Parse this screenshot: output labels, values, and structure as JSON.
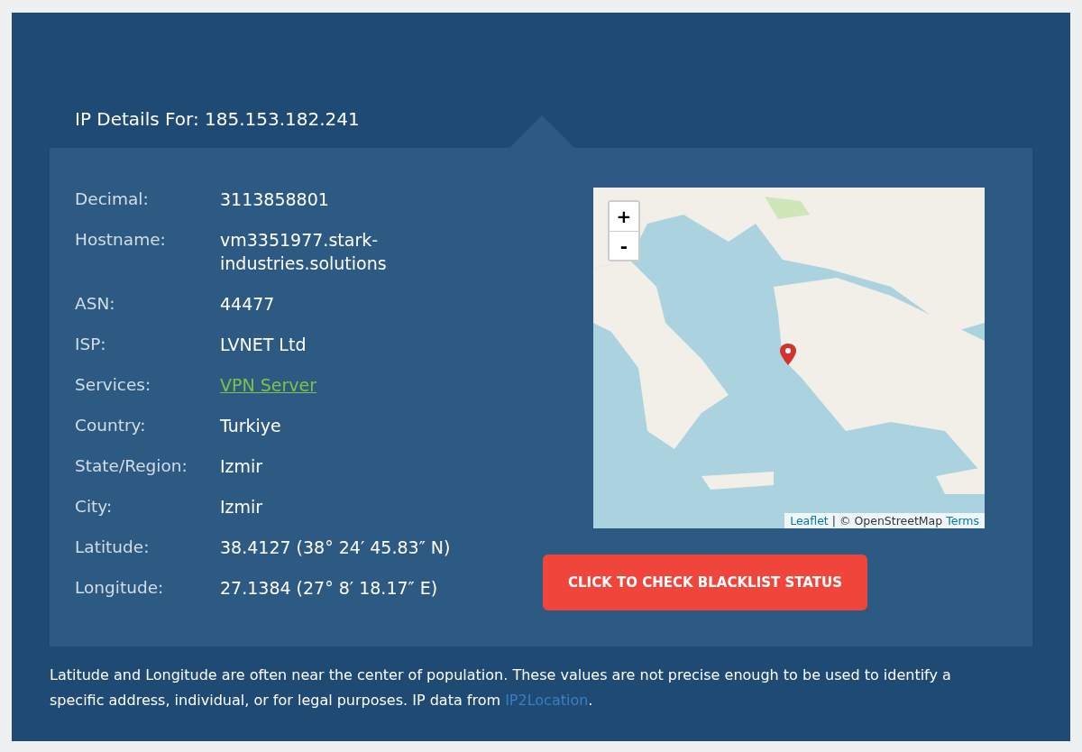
{
  "heading": "IP Details For: 185.153.182.241",
  "details": [
    {
      "label": "Decimal:",
      "value": "3113858801",
      "kind": "text"
    },
    {
      "label": "Hostname:",
      "value": "vm3351977.stark-industries.solutions",
      "kind": "text"
    },
    {
      "label": "ASN:",
      "value": "44477",
      "kind": "text"
    },
    {
      "label": "ISP:",
      "value": "LVNET Ltd",
      "kind": "text"
    },
    {
      "label": "Services:",
      "value": "VPN Server",
      "kind": "link"
    },
    {
      "label": "Country:",
      "value": "Turkiye",
      "kind": "text"
    },
    {
      "label": "State/Region:",
      "value": "Izmir",
      "kind": "text"
    },
    {
      "label": "City:",
      "value": "Izmir",
      "kind": "text"
    },
    {
      "label": "Latitude:",
      "value": "38.4127 (38° 24′ 45.83″ N)",
      "kind": "text"
    },
    {
      "label": "Longitude:",
      "value": "27.1384 (27° 8′ 18.17″ E)",
      "kind": "text"
    }
  ],
  "map": {
    "zoom_in": "+",
    "zoom_out": "-",
    "attribution": {
      "leaflet": "Leaflet",
      "separator": "|",
      "osm": "© OpenStreetMap",
      "terms": "Terms"
    }
  },
  "blacklist_button": "CLICK TO CHECK BLACKLIST STATUS",
  "footnote": {
    "text": "Latitude and Longitude are often near the center of population. These values are not precise enough to be used to identify a specific address, individual, or for legal purposes. IP data from ",
    "link": "IP2Location",
    "end": "."
  }
}
